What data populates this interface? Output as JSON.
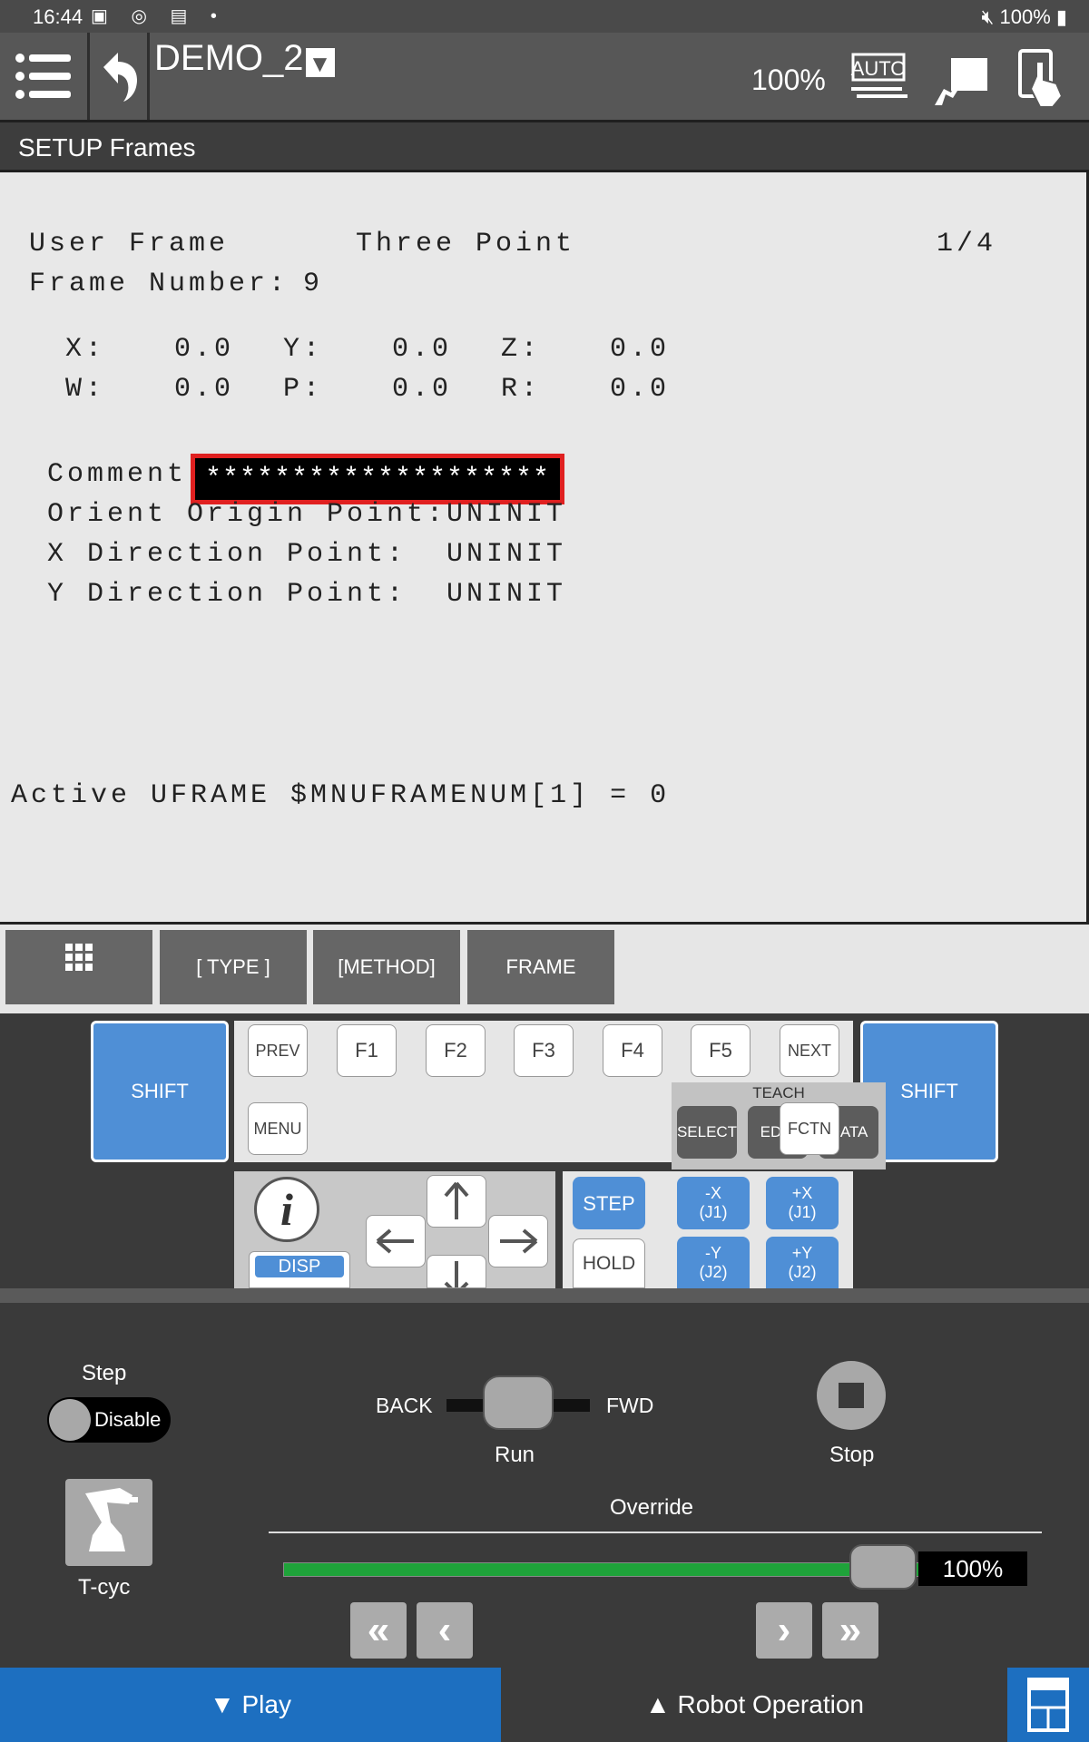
{
  "status_bar": {
    "time": "16:44",
    "battery": "100%"
  },
  "top_bar": {
    "program_name": "DEMO_2",
    "zoom": "100%",
    "mode_badge": "AUTO"
  },
  "header": {
    "title": "SETUP Frames"
  },
  "screen": {
    "frame_type": "User Frame",
    "method": "Three Point",
    "page": "1/4",
    "frame_number_label": "Frame Number:",
    "frame_number": "9",
    "coords": [
      {
        "label": "X:",
        "value": "0.0"
      },
      {
        "label": "Y:",
        "value": "0.0"
      },
      {
        "label": "Z:",
        "value": "0.0"
      },
      {
        "label": "W:",
        "value": "0.0"
      },
      {
        "label": "P:",
        "value": "0.0"
      },
      {
        "label": "R:",
        "value": "0.0"
      }
    ],
    "comment_label": "Comment:",
    "comment_value": "********************",
    "points": [
      {
        "label": "Orient Origin Point:",
        "value": "UNINIT"
      },
      {
        "label": "X Direction Point:",
        "value": "UNINIT"
      },
      {
        "label": "Y Direction Point:",
        "value": "UNINIT"
      }
    ],
    "active_line": "Active UFRAME $MNUFRAMENUM[1] = 0"
  },
  "function_keys": [
    "[ TYPE ]",
    "[METHOD]",
    "FRAME"
  ],
  "keypad": {
    "shift": "SHIFT",
    "top_row": [
      "PREV",
      "F1",
      "F2",
      "F3",
      "F4",
      "F5",
      "NEXT"
    ],
    "menu": "MENU",
    "fctn": "FCTN",
    "teach_label": "TEACH",
    "teach_keys": [
      "SELECT",
      "EDIT",
      "DATA"
    ],
    "disp": "DISP",
    "step": "STEP",
    "hold": "HOLD",
    "jog": [
      {
        "top": "-X",
        "bottom": "(J1)"
      },
      {
        "top": "+X",
        "bottom": "(J1)"
      },
      {
        "top": "-Y",
        "bottom": "(J2)"
      },
      {
        "top": "+Y",
        "bottom": "(J2)"
      }
    ]
  },
  "operation": {
    "step_label": "Step",
    "step_toggle": "Disable",
    "back": "BACK",
    "fwd": "FWD",
    "run": "Run",
    "stop": "Stop",
    "tcyc": "T-cyc",
    "override_label": "Override",
    "override_value": "100%",
    "override_fraction": 1.0
  },
  "bottom_tabs": {
    "play": "▼ Play",
    "robot_operation": "▲ Robot Operation"
  },
  "colors": {
    "accent_blue": "#4f8fd6",
    "tab_blue": "#1d6fc0",
    "override_green": "#1fa33a",
    "comment_border": "#e02020"
  }
}
